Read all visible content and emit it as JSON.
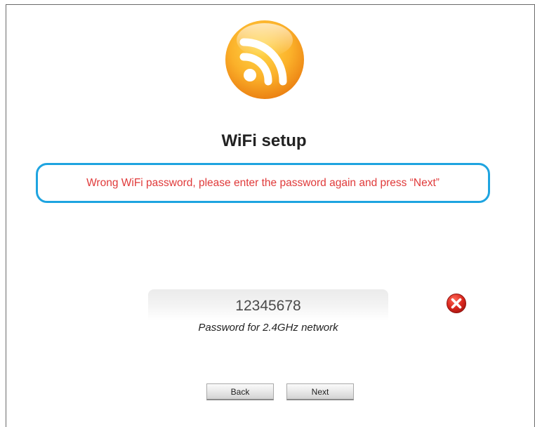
{
  "logo": {
    "icon": "rss-wifi-icon",
    "colors": {
      "outer": "#f7941d",
      "inner": "#ffcc33",
      "glyph": "#ffffff"
    }
  },
  "page": {
    "title": "WiFi setup",
    "error_message": "Wrong WiFi password, please enter the password again and press “Next”"
  },
  "password_field": {
    "value": "12345678",
    "caption": "Password for 2.4GHz network",
    "clear_icon": "red-x-circle-icon"
  },
  "buttons": {
    "back_label": "Back",
    "next_label": "Next"
  },
  "colors": {
    "error_text": "#e03a3a",
    "error_border": "#1ea4e0",
    "clear_icon": "#d9261c"
  }
}
